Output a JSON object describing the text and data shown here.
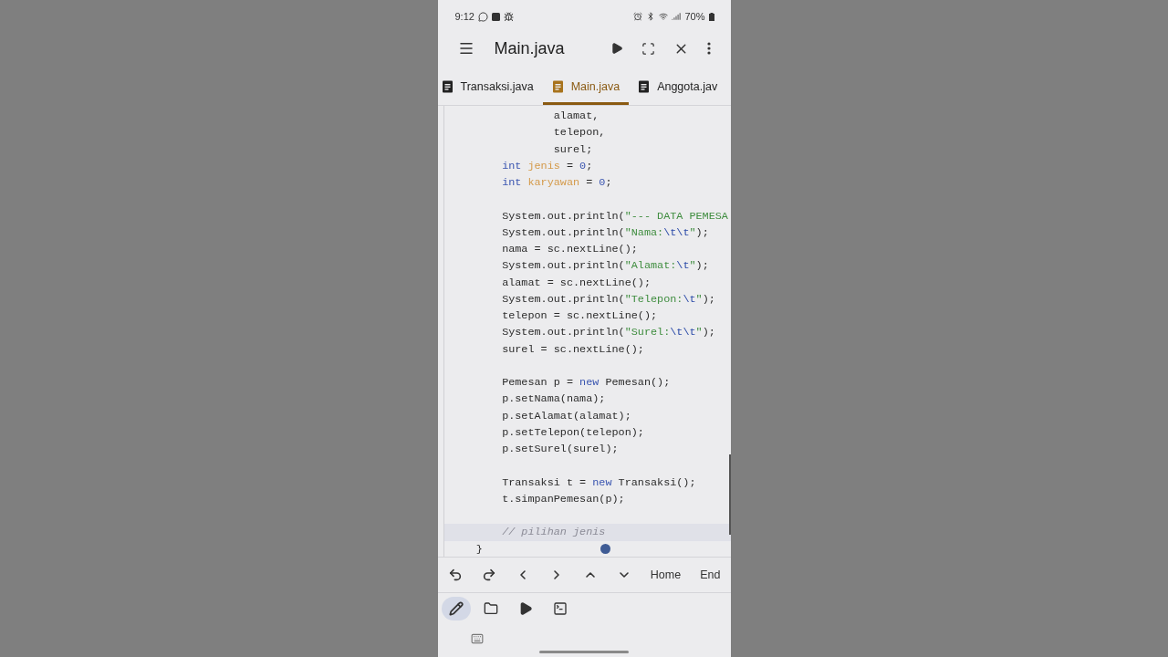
{
  "status_bar": {
    "time": "9:12",
    "battery": "70%"
  },
  "toolbar": {
    "title": "Main.java"
  },
  "tabs": [
    {
      "label": "Transaksi.java",
      "selected": false
    },
    {
      "label": "Main.java",
      "selected": true
    },
    {
      "label": "Anggota.jav",
      "selected": false
    }
  ],
  "editor": {
    "lines": [
      {
        "current": false,
        "tokens": [
          {
            "kind": "plain",
            "text": "                alamat,"
          }
        ]
      },
      {
        "current": false,
        "tokens": [
          {
            "kind": "plain",
            "text": "                telepon,"
          }
        ]
      },
      {
        "current": false,
        "tokens": [
          {
            "kind": "plain",
            "text": "                surel;"
          }
        ]
      },
      {
        "current": false,
        "tokens": [
          {
            "kind": "keyword",
            "text": "        int"
          },
          {
            "kind": "variable",
            "text": " jenis"
          },
          {
            "kind": "plain",
            "text": " = "
          },
          {
            "kind": "number",
            "text": "0"
          },
          {
            "kind": "plain",
            "text": ";"
          }
        ]
      },
      {
        "current": false,
        "tokens": [
          {
            "kind": "keyword",
            "text": "        int"
          },
          {
            "kind": "variable",
            "text": " karyawan"
          },
          {
            "kind": "plain",
            "text": " = "
          },
          {
            "kind": "number",
            "text": "0"
          },
          {
            "kind": "plain",
            "text": ";"
          }
        ]
      },
      {
        "current": false
      },
      {
        "current": false,
        "tokens": [
          {
            "kind": "plain",
            "text": "        System.out.println("
          },
          {
            "kind": "string",
            "text": "\"--- DATA PEMESA"
          }
        ]
      },
      {
        "current": false,
        "tokens": [
          {
            "kind": "plain",
            "text": "        System.out.println("
          },
          {
            "kind": "string",
            "text": "\"Nama:"
          },
          {
            "kind": "escape",
            "text": "\\t\\t"
          },
          {
            "kind": "string",
            "text": "\""
          },
          {
            "kind": "plain",
            "text": ");"
          }
        ]
      },
      {
        "current": false,
        "tokens": [
          {
            "kind": "plain",
            "text": "        nama = sc.nextLine();"
          }
        ]
      },
      {
        "current": false,
        "tokens": [
          {
            "kind": "plain",
            "text": "        System.out.println("
          },
          {
            "kind": "string",
            "text": "\"Alamat:"
          },
          {
            "kind": "escape",
            "text": "\\t"
          },
          {
            "kind": "string",
            "text": "\""
          },
          {
            "kind": "plain",
            "text": ");"
          }
        ]
      },
      {
        "current": false,
        "tokens": [
          {
            "kind": "plain",
            "text": "        alamat = sc.nextLine();"
          }
        ]
      },
      {
        "current": false,
        "tokens": [
          {
            "kind": "plain",
            "text": "        System.out.println("
          },
          {
            "kind": "string",
            "text": "\"Telepon:"
          },
          {
            "kind": "escape",
            "text": "\\t"
          },
          {
            "kind": "string",
            "text": "\""
          },
          {
            "kind": "plain",
            "text": ");"
          }
        ]
      },
      {
        "current": false,
        "tokens": [
          {
            "kind": "plain",
            "text": "        telepon = sc.nextLine();"
          }
        ]
      },
      {
        "current": false,
        "tokens": [
          {
            "kind": "plain",
            "text": "        System.out.println("
          },
          {
            "kind": "string",
            "text": "\"Surel:"
          },
          {
            "kind": "escape",
            "text": "\\t\\t"
          },
          {
            "kind": "string",
            "text": "\""
          },
          {
            "kind": "plain",
            "text": ");"
          }
        ]
      },
      {
        "current": false,
        "tokens": [
          {
            "kind": "plain",
            "text": "        surel = sc.nextLine();"
          }
        ]
      },
      {
        "current": false
      },
      {
        "current": false,
        "tokens": [
          {
            "kind": "plain",
            "text": "        Pemesan p = "
          },
          {
            "kind": "keyword",
            "text": "new"
          },
          {
            "kind": "plain",
            "text": " Pemesan();"
          }
        ]
      },
      {
        "current": false,
        "tokens": [
          {
            "kind": "plain",
            "text": "        p.setNama(nama);"
          }
        ]
      },
      {
        "current": false,
        "tokens": [
          {
            "kind": "plain",
            "text": "        p.setAlamat(alamat);"
          }
        ]
      },
      {
        "current": false,
        "tokens": [
          {
            "kind": "plain",
            "text": "        p.setTelepon(telepon);"
          }
        ]
      },
      {
        "current": false,
        "tokens": [
          {
            "kind": "plain",
            "text": "        p.setSurel(surel);"
          }
        ]
      },
      {
        "current": false
      },
      {
        "current": false,
        "tokens": [
          {
            "kind": "plain",
            "text": "        Transaksi t = "
          },
          {
            "kind": "keyword",
            "text": "new"
          },
          {
            "kind": "plain",
            "text": " Transaksi();"
          }
        ]
      },
      {
        "current": false,
        "tokens": [
          {
            "kind": "plain",
            "text": "        t.simpanPemesan(p);"
          }
        ]
      },
      {
        "current": false
      },
      {
        "current": true,
        "tokens": [
          {
            "kind": "comment",
            "text": "        // pilihan jenis"
          }
        ]
      },
      {
        "current": false,
        "tokens": [
          {
            "kind": "plain",
            "text": "    }"
          }
        ]
      }
    ]
  },
  "keys": [
    {
      "kind": "undo"
    },
    {
      "kind": "redo"
    },
    {
      "kind": "left"
    },
    {
      "kind": "right"
    },
    {
      "kind": "up"
    },
    {
      "kind": "down"
    },
    {
      "kind": "text",
      "label": "Home"
    },
    {
      "kind": "text",
      "label": "End"
    }
  ],
  "tools": [
    {
      "kind": "edit",
      "selected": true
    },
    {
      "kind": "files",
      "selected": false
    },
    {
      "kind": "run",
      "selected": false
    },
    {
      "kind": "terminal",
      "selected": false
    }
  ]
}
